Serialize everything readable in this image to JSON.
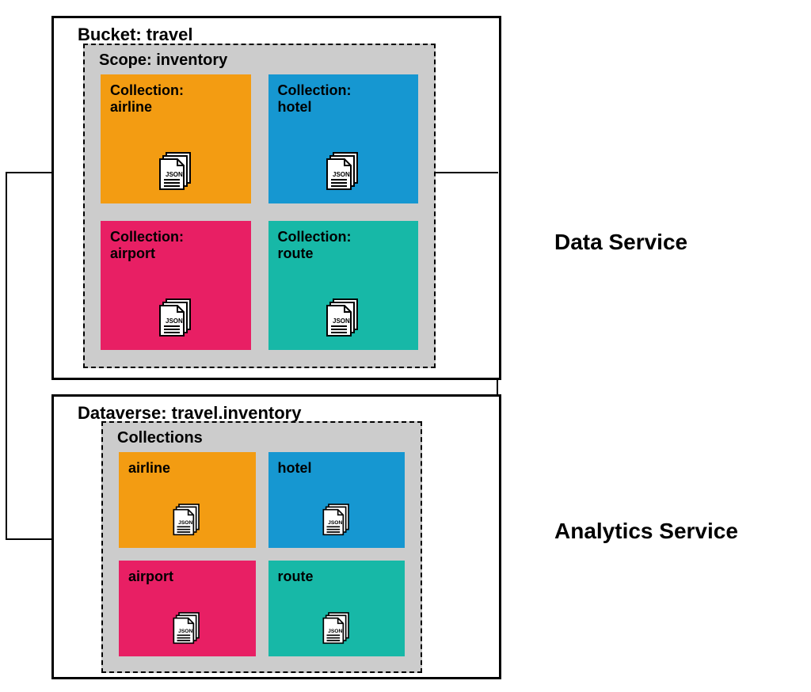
{
  "top": {
    "outer_title": "Bucket: travel",
    "inner_title": "Scope: inventory",
    "tiles": [
      {
        "label": "Collection:\nairline",
        "color": "orange"
      },
      {
        "label": "Collection:\nhotel",
        "color": "blue"
      },
      {
        "label": "Collection:\nairport",
        "color": "pink"
      },
      {
        "label": "Collection:\nroute",
        "color": "teal"
      }
    ]
  },
  "bottom": {
    "outer_title": "Dataverse: travel.inventory",
    "inner_title": "Collections",
    "tiles": [
      {
        "label": "airline",
        "color": "orange"
      },
      {
        "label": "hotel",
        "color": "blue"
      },
      {
        "label": "airport",
        "color": "pink"
      },
      {
        "label": "route",
        "color": "teal"
      }
    ]
  },
  "labels": {
    "data_service": "Data Service",
    "analytics_service": "Analytics Service"
  }
}
